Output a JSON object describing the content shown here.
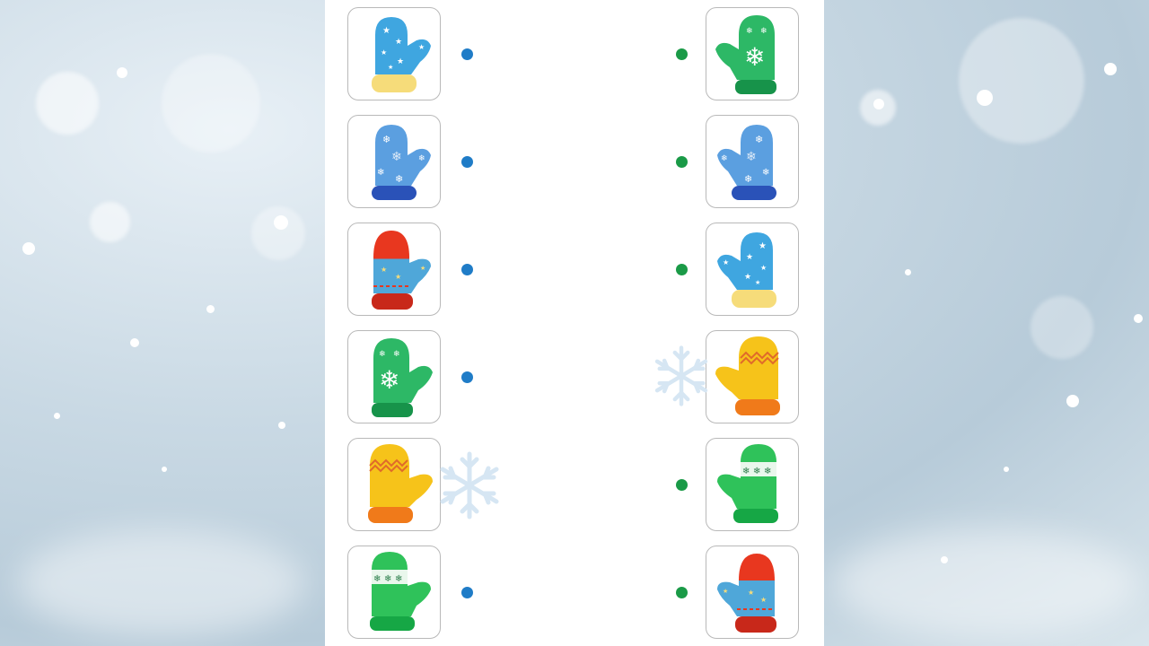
{
  "game": {
    "left_column": [
      {
        "mitten": "blue-stars",
        "dot": "blue"
      },
      {
        "mitten": "blue-snowflakes",
        "dot": "blue"
      },
      {
        "mitten": "red-cap-blue-stars",
        "dot": "blue"
      },
      {
        "mitten": "green-snowflake",
        "dot": "blue"
      },
      {
        "mitten": "yellow-zigzag",
        "dot": null
      },
      {
        "mitten": "green-white-band",
        "dot": "blue"
      }
    ],
    "right_column": [
      {
        "mitten": "green-snowflake",
        "dot": "green"
      },
      {
        "mitten": "blue-snowflakes",
        "dot": "green"
      },
      {
        "mitten": "blue-stars",
        "dot": "green"
      },
      {
        "mitten": "yellow-zigzag",
        "dot": null
      },
      {
        "mitten": "green-white-band",
        "dot": "green"
      },
      {
        "mitten": "red-cap-blue-stars",
        "dot": "green"
      }
    ],
    "colors": {
      "left_dot": "#1f7cc7",
      "right_dot": "#1a9a47",
      "sheet": "#ffffff",
      "card_border": "#b9b9b9"
    }
  }
}
